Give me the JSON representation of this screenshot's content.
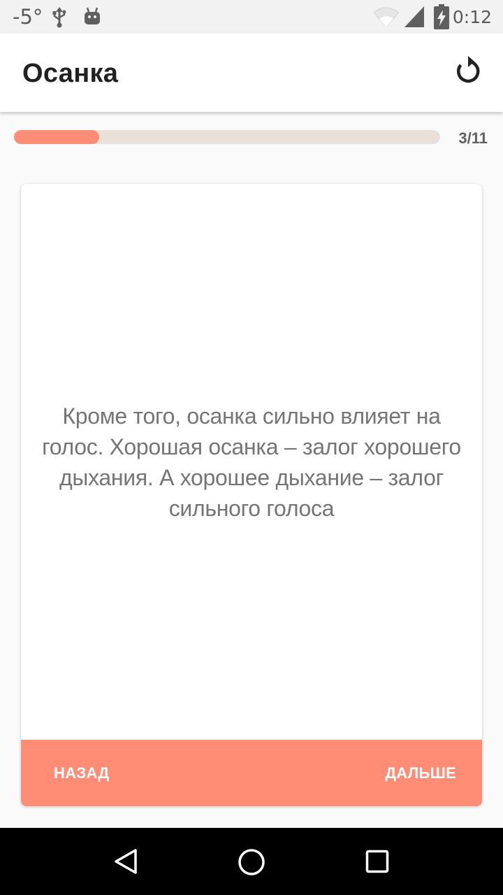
{
  "status_bar": {
    "temperature": "-5°",
    "time": "0:12",
    "icons": [
      "usb-icon",
      "android-icon",
      "wifi-icon",
      "signal-icon",
      "battery-charging-icon"
    ]
  },
  "app_bar": {
    "title": "Осанка",
    "reset_icon": "reset-icon"
  },
  "progress": {
    "current": 3,
    "total": 11,
    "label": "3/11",
    "fraction": 0.2,
    "fill_color": "#ff8d76",
    "track_color": "#eae0da"
  },
  "card": {
    "text": "Кроме того, осанка сильно влияет на голос. Хорошая осанка – залог хорошего дыхания. А хорошее дыхание – залог сильного голоса",
    "back_label": "НАЗАД",
    "next_label": "ДАЛЬШЕ",
    "footer_color": "#ff8d76"
  },
  "navigation_bar": {
    "icons": [
      "back-icon",
      "home-icon",
      "recents-icon"
    ]
  }
}
